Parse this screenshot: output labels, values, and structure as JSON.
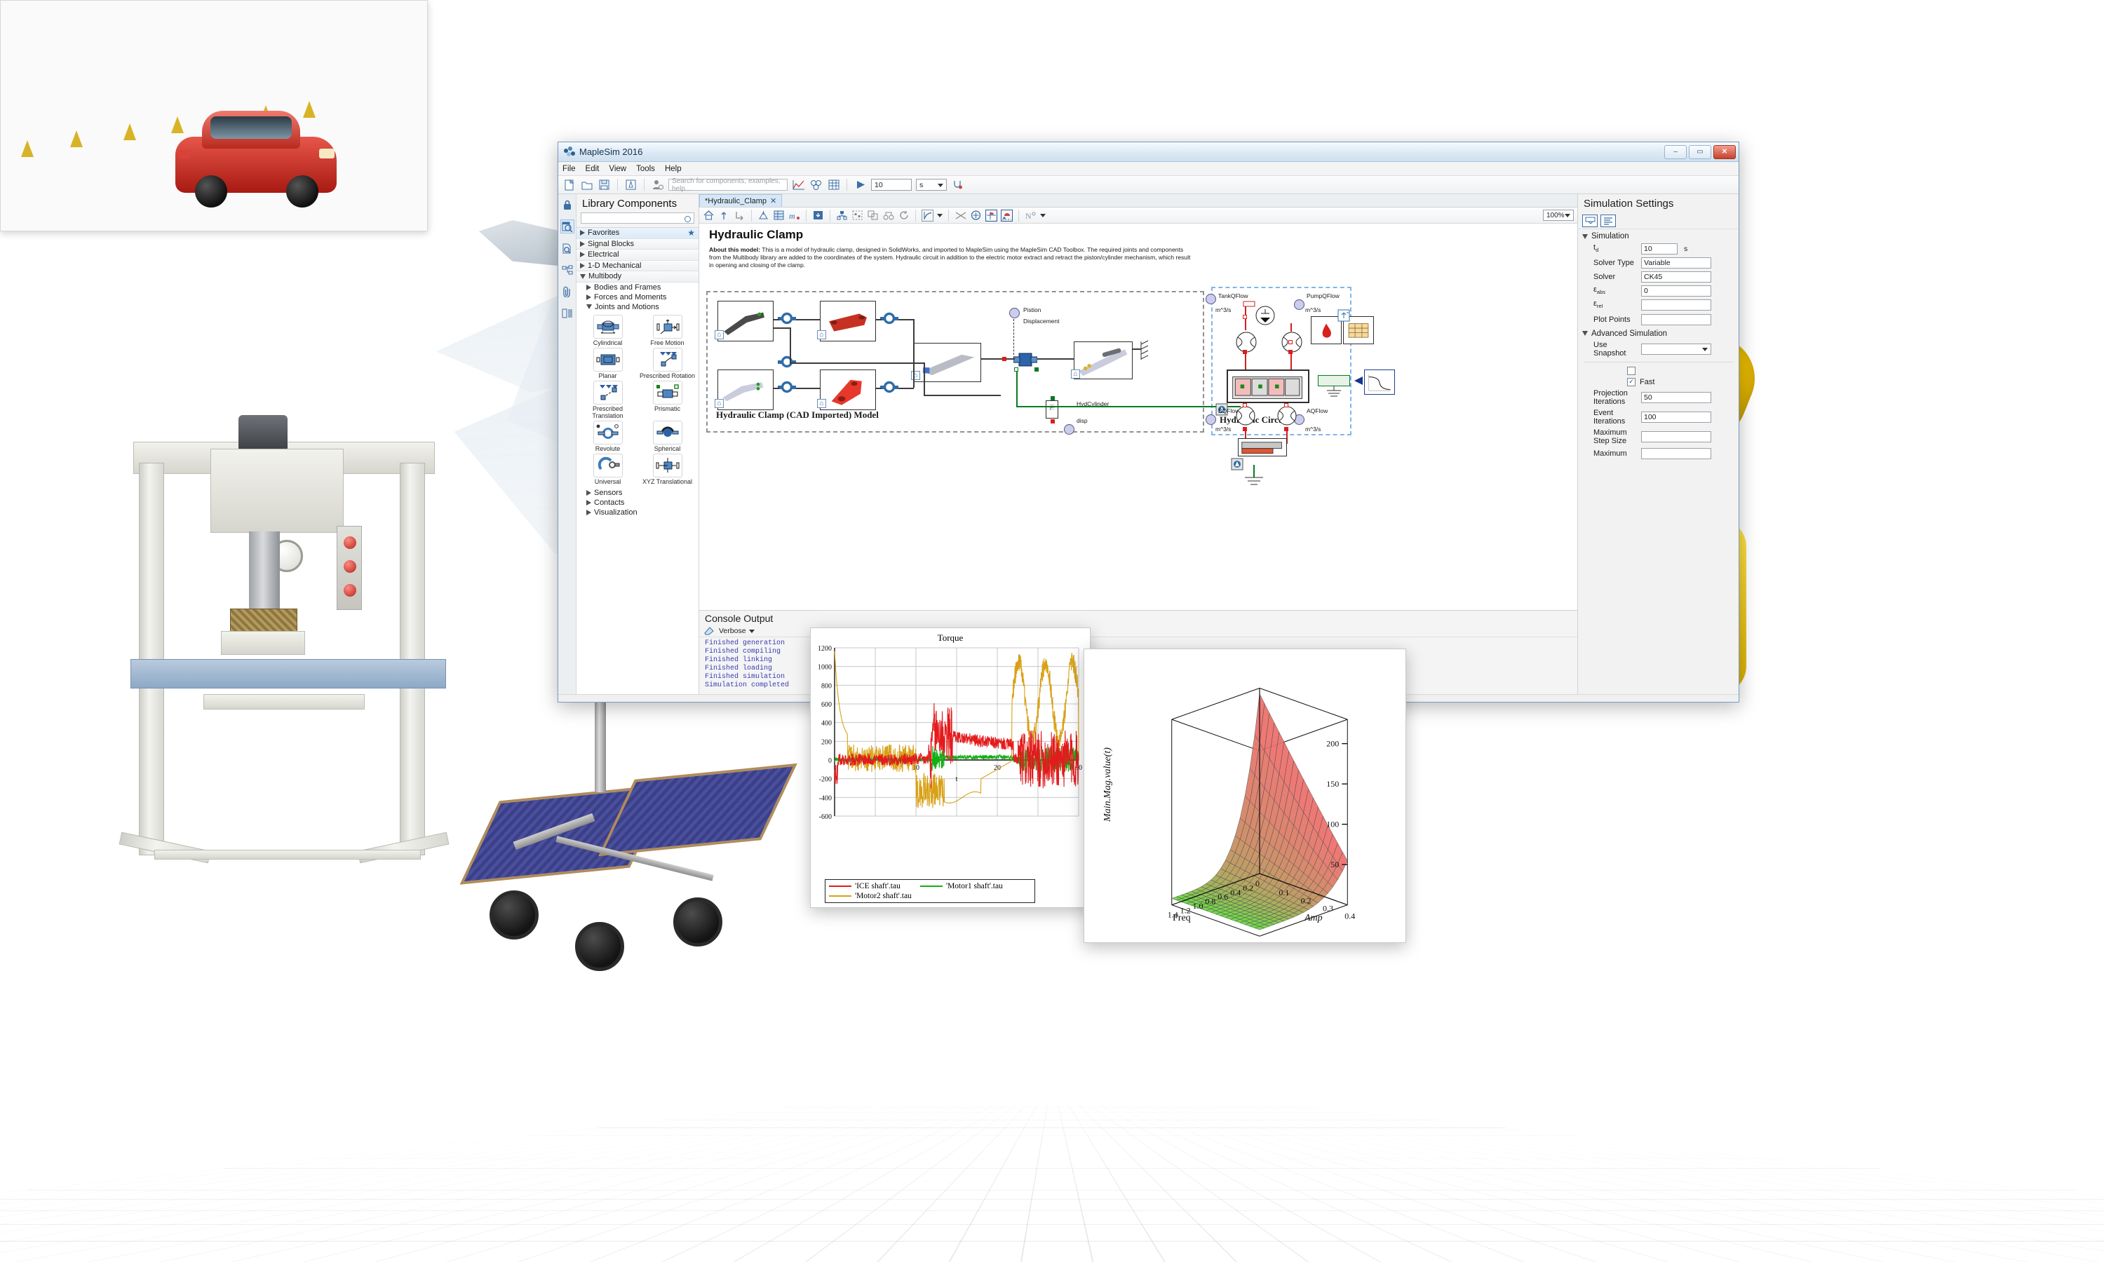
{
  "window": {
    "title": "MapleSim 2016",
    "app_icon": "maplesim-leaf-icon",
    "minimize_label": "–",
    "maximize_label": "▭",
    "close_label": "✕"
  },
  "menubar": {
    "items": [
      "File",
      "Edit",
      "View",
      "Tools",
      "Help"
    ]
  },
  "toolbar": {
    "icons": [
      "new-document-icon",
      "open-folder-icon",
      "save-disk-icon",
      "maple-document-icon",
      "attach-user-icon"
    ],
    "search_placeholder": "Search for components, examples, help...",
    "plot_icon": "plot-graph-icon",
    "model_icon": "3d-model-icon",
    "matrix_icon": "parameter-table-icon",
    "run_icon": "run-simulation-icon",
    "duration_value": "10",
    "duration_unit": "s",
    "probe_icon": "stethoscope-diagnose-icon"
  },
  "rail": {
    "icons": [
      "lock-icon",
      "library-search-icon",
      "document-search-icon",
      "model-tree-icon",
      "attachments-clip-icon",
      "parameters-grid-icon"
    ]
  },
  "library": {
    "title": "Library Components",
    "search_placeholder": "",
    "tree": [
      {
        "label": "Favorites",
        "expanded": false,
        "starred": true
      },
      {
        "label": "Signal Blocks",
        "expanded": false
      },
      {
        "label": "Electrical",
        "expanded": false
      },
      {
        "label": "1-D Mechanical",
        "expanded": false
      },
      {
        "label": "Multibody",
        "expanded": true
      }
    ],
    "subtree": [
      {
        "label": "Bodies and Frames",
        "expanded": false
      },
      {
        "label": "Forces and Moments",
        "expanded": false
      },
      {
        "label": "Joints and Motions",
        "expanded": true
      }
    ],
    "palette": [
      {
        "label": "Cylindrical",
        "icon": "cylindrical-joint-icon"
      },
      {
        "label": "Free Motion",
        "icon": "free-motion-joint-icon"
      },
      {
        "label": "Planar",
        "icon": "planar-joint-icon"
      },
      {
        "label": "Prescribed Rotation",
        "icon": "prescribed-rotation-icon"
      },
      {
        "label": "Prescribed Translation",
        "icon": "prescribed-translation-icon"
      },
      {
        "label": "Prismatic",
        "icon": "prismatic-joint-icon"
      },
      {
        "label": "Revolute",
        "icon": "revolute-joint-icon"
      },
      {
        "label": "Spherical",
        "icon": "spherical-joint-icon"
      },
      {
        "label": "Universal",
        "icon": "universal-joint-icon"
      },
      {
        "label": "XYZ Translational",
        "icon": "xyz-translational-icon"
      }
    ],
    "tail_items": [
      "Sensors",
      "Contacts",
      "Visualization"
    ]
  },
  "tabs": [
    {
      "label": "*Hydraulic_Clamp",
      "close": "✕",
      "active": true
    }
  ],
  "canvas_toolbar": {
    "icons": [
      "home-view-icon",
      "navigate-up-icon",
      "navigate-into-icon",
      "attach-subsystem-icon",
      "parameter-table-icon",
      "maple-math-icon",
      "download-subsystem-icon",
      "align-tree-icon",
      "group-icon",
      "ungroup-icon",
      "flip-icon",
      "rotate-icon",
      "mirror-icon",
      "shuffle-icon",
      "add-probe-icon",
      "snap-grid-icon",
      "snap-point-icon",
      "connection-style-icon"
    ],
    "zoom": "100%"
  },
  "document": {
    "title": "Hydraulic Clamp",
    "about_label": "About this model:",
    "about_text": "This is a model of hydraulic clamp, designed in SolidWorks, and imported to MapleSim using the MapleSim CAD Toolbox. The required joints and components from the Multibody library are added to the coordinates of the system. Hydraulic circuit in addition to the electric motor extract and retract the piston/cylinder mechanism, which result in opening and closing of the  clamp.",
    "group_left_caption": "Hydraulic Clamp (CAD Imported) Model",
    "group_right_caption": "Hydraulic Circuit",
    "annotations": [
      "Pistion",
      "Displacement",
      "HydCylinder",
      "disp",
      "TankQFlow",
      "PumpQFlow",
      "BQFlow",
      "AQFlow",
      "m^3/s",
      "m^3/s",
      "m^3/s",
      "m^3/s"
    ]
  },
  "console": {
    "title": "Console Output",
    "clear_icon": "eraser-clear-icon",
    "level": "Verbose",
    "lines": [
      "Finished generation",
      "Finished compiling",
      "Finished linking",
      "Finished loading",
      "Finished simulation",
      "Simulation completed"
    ]
  },
  "settings": {
    "title": "Simulation Settings",
    "tab_icons": [
      "settings-basic-icon",
      "settings-list-icon"
    ],
    "sections": [
      {
        "label": "Simulation",
        "expanded": true
      },
      {
        "label": "Advanced Simulation",
        "expanded": true
      }
    ],
    "fields": [
      {
        "key": "t_d",
        "key_main": "t",
        "key_sub": "d",
        "value": "10",
        "unit": "s"
      },
      {
        "key": "Solver Type",
        "value": "Variable"
      },
      {
        "key": "Solver",
        "value": "CK45"
      },
      {
        "key": "e_abs",
        "key_main": "ε",
        "key_sub": "abs",
        "value": "0"
      },
      {
        "key": "e_rel",
        "key_main": "ε",
        "key_sub": "rel",
        "value": ""
      },
      {
        "key": "Plot Points",
        "value": ""
      },
      {
        "key": "Use Snapshot",
        "value": ""
      },
      {
        "key": "Projection Iterations",
        "value": "50"
      },
      {
        "key": "Event Iterations",
        "value": "100"
      },
      {
        "key": "Maximum Step Size",
        "value": ""
      },
      {
        "key": "Maximum",
        "value": ""
      }
    ],
    "checkboxes": [
      {
        "label": "",
        "checked": false
      },
      {
        "label": "Fast",
        "checked": true
      }
    ]
  },
  "chart_data": [
    {
      "type": "line",
      "title": "Torque",
      "xlabel": "t",
      "ylabel": "",
      "xlim": [
        0,
        30
      ],
      "ylim": [
        -600,
        1200
      ],
      "xticks": [
        "10",
        "20",
        "30"
      ],
      "yticks": [
        "1200",
        "1000",
        "800",
        "600",
        "400",
        "200",
        "0",
        "-200",
        "-400",
        "-600"
      ],
      "grid": true,
      "legend_position": "bottom",
      "series": [
        {
          "name": "'ICE shaft'.tau",
          "color": "#e41a1c"
        },
        {
          "name": "'Motor1 shaft'.tau",
          "color": "#12b012"
        },
        {
          "name": "'Motor2 shaft'.tau",
          "color": "#d8a115"
        }
      ]
    },
    {
      "type": "surface",
      "title": "",
      "xlabel": "Freq",
      "ylabel": "Amp",
      "zlabel": "Main.Mag.value(t)",
      "xticks": [
        "1.4",
        "1.2",
        "1.0",
        "0.8",
        "0.6",
        "0.4",
        "0.2",
        "0"
      ],
      "yticks": [
        "0.1",
        "0.2",
        "0.3",
        "0.4"
      ],
      "zticks": [
        "50",
        "100",
        "150",
        "200"
      ],
      "zlim": [
        0,
        230
      ],
      "colormap": "green-yellow-red",
      "grid": true
    }
  ],
  "scenery": {
    "press": "hydraulic-press-photo",
    "jet": "fighter-jet-photo",
    "rover": "mars-rover-render",
    "robot": "industrial-robot-arm-photo",
    "clamp": "hydraulic-clamp-3d-render",
    "viewport_car": "red-car-3d-render"
  }
}
